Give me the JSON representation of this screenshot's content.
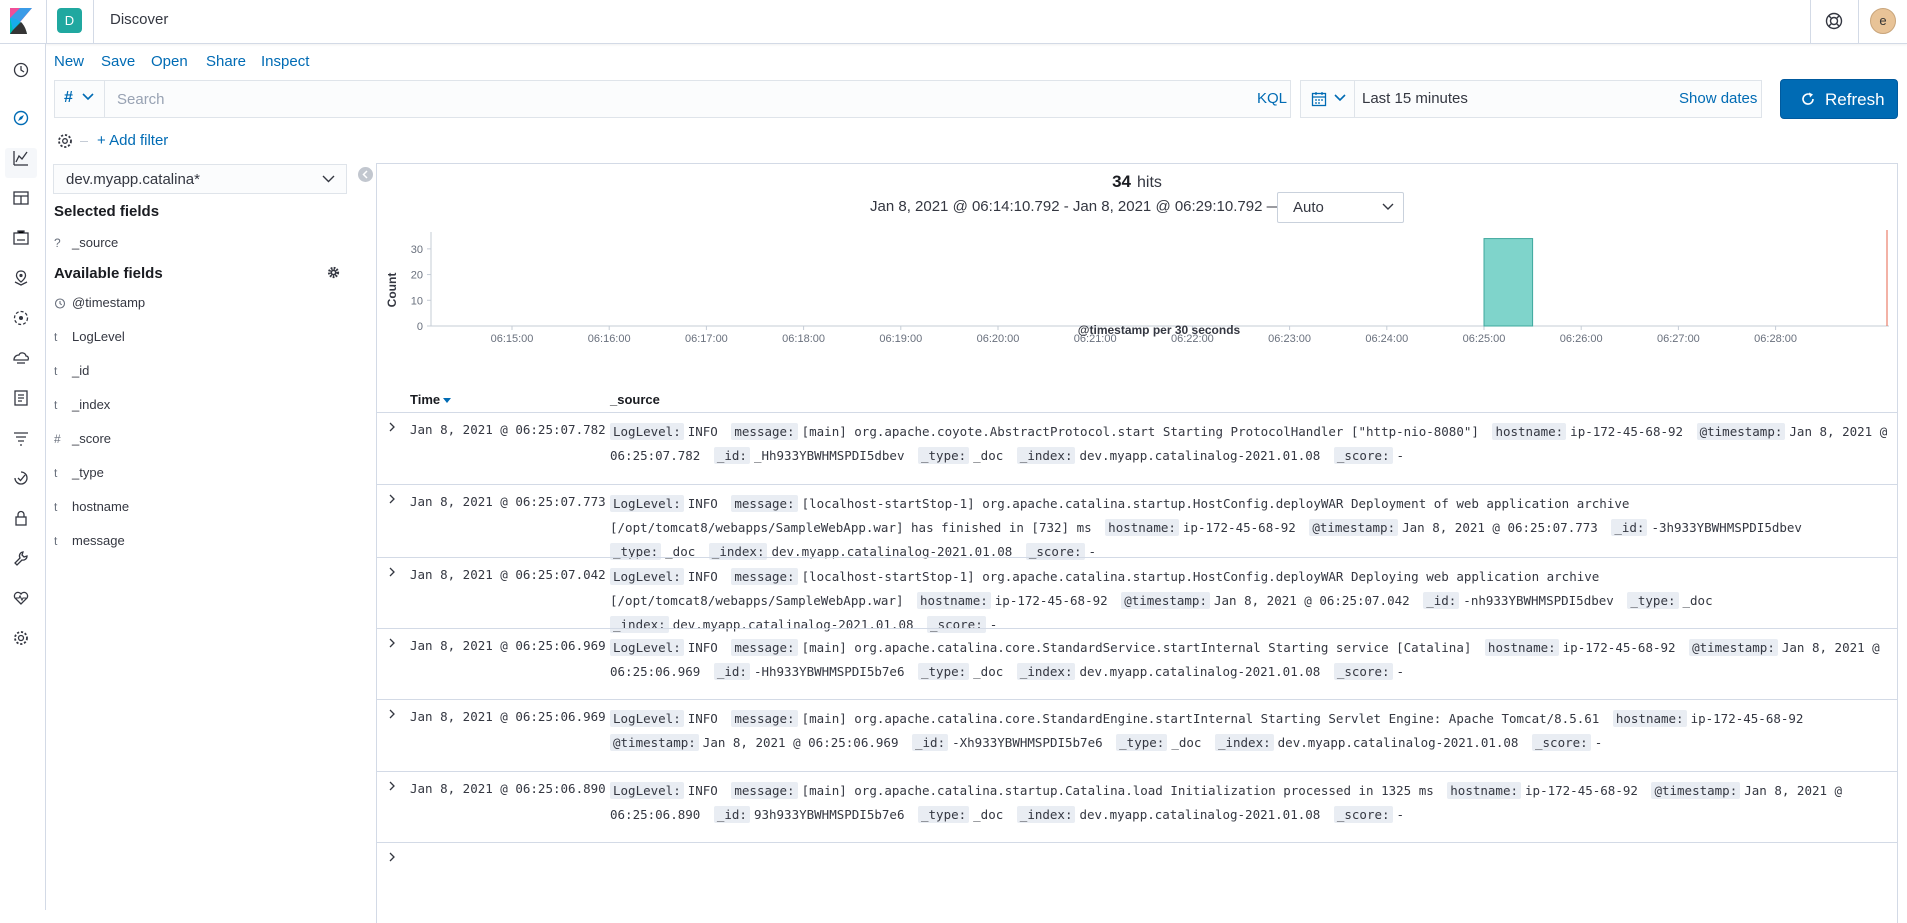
{
  "header": {
    "space_initial": "D",
    "app_title": "Discover",
    "user_initial": "e"
  },
  "menu": {
    "new": "New",
    "save": "Save",
    "open": "Open",
    "share": "Share",
    "inspect": "Inspect"
  },
  "query": {
    "lang_symbol": "#",
    "placeholder": "Search",
    "value": "",
    "kql": "KQL"
  },
  "date": {
    "range": "Last 15 minutes",
    "show_dates": "Show dates",
    "refresh": "Refresh"
  },
  "filter": {
    "add_filter": "+ Add filter"
  },
  "sidebar": {
    "index_pattern": "dev.myapp.catalina*",
    "selected_heading": "Selected fields",
    "selected_fields": [
      {
        "type": "?",
        "name": "_source"
      }
    ],
    "available_heading": "Available fields",
    "available_fields": [
      {
        "type": "clock",
        "name": "@timestamp"
      },
      {
        "type": "t",
        "name": "LogLevel"
      },
      {
        "type": "t",
        "name": "_id"
      },
      {
        "type": "t",
        "name": "_index"
      },
      {
        "type": "#",
        "name": "_score"
      },
      {
        "type": "t",
        "name": "_type"
      },
      {
        "type": "t",
        "name": "hostname"
      },
      {
        "type": "t",
        "name": "message"
      }
    ]
  },
  "results": {
    "hit_count": "34",
    "hits_label": "hits",
    "time_range": "Jan 8, 2021 @ 06:14:10.792 - Jan 8, 2021 @ 06:29:10.792 —",
    "interval": "Auto"
  },
  "chart_data": {
    "type": "bar",
    "title": "",
    "xlabel": "@timestamp per 30 seconds",
    "ylabel": "Count",
    "ylim": [
      0,
      35
    ],
    "yticks": [
      0,
      10,
      20,
      30
    ],
    "xticks": [
      "06:15:00",
      "06:16:00",
      "06:17:00",
      "06:18:00",
      "06:19:00",
      "06:20:00",
      "06:21:00",
      "06:22:00",
      "06:23:00",
      "06:24:00",
      "06:25:00",
      "06:26:00",
      "06:27:00",
      "06:28:00"
    ],
    "x_start": "06:14:10",
    "x_end": "06:29:10",
    "bars": [
      {
        "start": "06:25:00",
        "end": "06:25:30",
        "value": 34
      }
    ],
    "bar_color": "#7fd4cb",
    "now_marker": "06:29:10",
    "now_marker_color": "#e7664c",
    "legend": "none",
    "grid": false
  },
  "table": {
    "col_time": "Time",
    "col_source": "_source",
    "rows": [
      {
        "time": "Jan 8, 2021 @ 06:25:07.782",
        "fields": [
          {
            "k": "LogLevel:",
            "v": "INFO"
          },
          {
            "k": "message:",
            "v": "[main] org.apache.coyote.AbstractProtocol.start Starting ProtocolHandler [\"http-nio-8080\"]"
          },
          {
            "k": "hostname:",
            "v": "ip-172-45-68-92"
          },
          {
            "k": "@timestamp:",
            "v": "Jan 8, 2021 @ 06:25:07.782"
          },
          {
            "k": "_id:",
            "v": "_Hh933YBWHMSPDI5dbev"
          },
          {
            "k": "_type:",
            "v": "_doc"
          },
          {
            "k": "_index:",
            "v": "dev.myapp.catalinalog-2021.01.08"
          },
          {
            "k": "_score:",
            "v": "-"
          }
        ]
      },
      {
        "time": "Jan 8, 2021 @ 06:25:07.773",
        "fields": [
          {
            "k": "LogLevel:",
            "v": "INFO"
          },
          {
            "k": "message:",
            "v": "[localhost-startStop-1] org.apache.catalina.startup.HostConfig.deployWAR Deployment of web application archive [/opt/tomcat8/webapps/SampleWebApp.war] has finished in [732] ms"
          },
          {
            "k": "hostname:",
            "v": "ip-172-45-68-92"
          },
          {
            "k": "@timestamp:",
            "v": "Jan 8, 2021 @ 06:25:07.773"
          },
          {
            "k": "_id:",
            "v": "-3h933YBWHMSPDI5dbev"
          },
          {
            "k": "_type:",
            "v": "_doc"
          },
          {
            "k": "_index:",
            "v": "dev.myapp.catalinalog-2021.01.08"
          },
          {
            "k": "_score:",
            "v": "-"
          }
        ]
      },
      {
        "time": "Jan 8, 2021 @ 06:25:07.042",
        "fields": [
          {
            "k": "LogLevel:",
            "v": "INFO"
          },
          {
            "k": "message:",
            "v": "[localhost-startStop-1] org.apache.catalina.startup.HostConfig.deployWAR Deploying web application archive [/opt/tomcat8/webapps/SampleWebApp.war]"
          },
          {
            "k": "hostname:",
            "v": "ip-172-45-68-92"
          },
          {
            "k": "@timestamp:",
            "v": "Jan 8, 2021 @ 06:25:07.042"
          },
          {
            "k": "_id:",
            "v": "-nh933YBWHMSPDI5dbev"
          },
          {
            "k": "_type:",
            "v": "_doc"
          },
          {
            "k": "_index:",
            "v": "dev.myapp.catalinalog-2021.01.08"
          },
          {
            "k": "_score:",
            "v": "-"
          }
        ]
      },
      {
        "time": "Jan 8, 2021 @ 06:25:06.969",
        "fields": [
          {
            "k": "LogLevel:",
            "v": "INFO"
          },
          {
            "k": "message:",
            "v": "[main] org.apache.catalina.core.StandardService.startInternal Starting service [Catalina]"
          },
          {
            "k": "hostname:",
            "v": "ip-172-45-68-92"
          },
          {
            "k": "@timestamp:",
            "v": "Jan 8, 2021 @ 06:25:06.969"
          },
          {
            "k": "_id:",
            "v": "-Hh933YBWHMSPDI5b7e6"
          },
          {
            "k": "_type:",
            "v": "_doc"
          },
          {
            "k": "_index:",
            "v": "dev.myapp.catalinalog-2021.01.08"
          },
          {
            "k": "_score:",
            "v": "-"
          }
        ]
      },
      {
        "time": "Jan 8, 2021 @ 06:25:06.969",
        "fields": [
          {
            "k": "LogLevel:",
            "v": "INFO"
          },
          {
            "k": "message:",
            "v": "[main] org.apache.catalina.core.StandardEngine.startInternal Starting Servlet Engine: Apache Tomcat/8.5.61"
          },
          {
            "k": "hostname:",
            "v": "ip-172-45-68-92"
          },
          {
            "k": "@timestamp:",
            "v": "Jan 8, 2021 @ 06:25:06.969"
          },
          {
            "k": "_id:",
            "v": "-Xh933YBWHMSPDI5b7e6"
          },
          {
            "k": "_type:",
            "v": "_doc"
          },
          {
            "k": "_index:",
            "v": "dev.myapp.catalinalog-2021.01.08"
          },
          {
            "k": "_score:",
            "v": "-"
          }
        ]
      },
      {
        "time": "Jan 8, 2021 @ 06:25:06.890",
        "fields": [
          {
            "k": "LogLevel:",
            "v": "INFO"
          },
          {
            "k": "message:",
            "v": "[main] org.apache.catalina.startup.Catalina.load Initialization processed in 1325 ms"
          },
          {
            "k": "hostname:",
            "v": "ip-172-45-68-92"
          },
          {
            "k": "@timestamp:",
            "v": "Jan 8, 2021 @ 06:25:06.890"
          },
          {
            "k": "_id:",
            "v": "93h933YBWHMSPDI5b7e6"
          },
          {
            "k": "_type:",
            "v": "_doc"
          },
          {
            "k": "_index:",
            "v": "dev.myapp.catalinalog-2021.01.08"
          },
          {
            "k": "_score:",
            "v": "-"
          }
        ]
      }
    ]
  },
  "colors": {
    "accent": "#006bb4",
    "space_badge": "#20a8a0",
    "bar": "#7fd4cb"
  }
}
